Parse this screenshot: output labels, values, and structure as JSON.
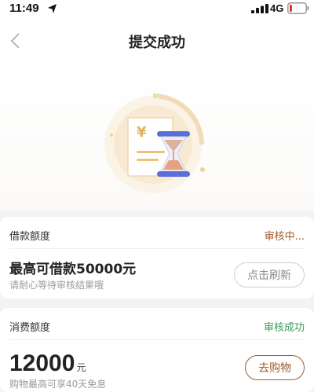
{
  "status_bar": {
    "time": "11:49",
    "network": "4G"
  },
  "nav": {
    "title": "提交成功"
  },
  "borrow_card": {
    "label": "借款额度",
    "status": "审核中...",
    "amount_text": "最高可借款50000元",
    "hint": "请耐心等待审核结果哦",
    "button": "点击刷新"
  },
  "consume_card": {
    "label": "消费额度",
    "status": "审核成功",
    "amount": "12000",
    "unit": "元",
    "hint": "购物最高可享40天免息",
    "button": "去购物"
  },
  "illustration": {
    "currency_symbol": "¥"
  },
  "colors": {
    "accent_brown": "#a05a2c",
    "success_green": "#3e9a5c",
    "hourglass_blue": "#5b6fd8"
  }
}
